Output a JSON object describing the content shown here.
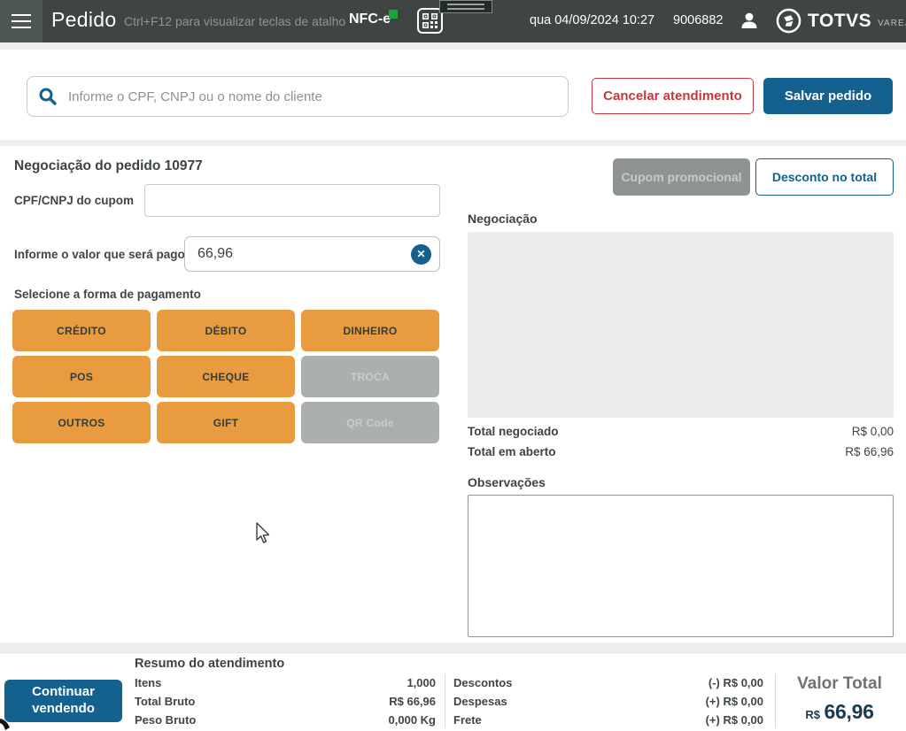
{
  "header": {
    "title": "Pedido",
    "shortcut_hint": "Ctrl+F12 para visualizar teclas de atalho",
    "nfce_label": "NFC-e",
    "datetime": "qua 04/09/2024 10:27",
    "terminal_number": "9006882",
    "brand": "TOTVS",
    "brand_segment": "VAREJO"
  },
  "search": {
    "placeholder": "Informe o CPF, CNPJ ou o nome do cliente",
    "cancel_button": "Cancelar atendimento",
    "save_button": "Salvar pedido"
  },
  "negotiation": {
    "title": "Negociação do pedido 10977",
    "coupon_cpf_label": "CPF/CNPJ do cupom",
    "coupon_cpf_value": "",
    "amount_label": "Informe o valor que será pago",
    "amount_value": "66,96",
    "clear_icon_glyph": "✕",
    "payment_section_label": "Selecione a forma de pagamento",
    "payment_methods": [
      {
        "label": "CRÉDITO",
        "enabled": true
      },
      {
        "label": "DÉBITO",
        "enabled": true
      },
      {
        "label": "DINHEIRO",
        "enabled": true
      },
      {
        "label": "POS",
        "enabled": true
      },
      {
        "label": "CHEQUE",
        "enabled": true
      },
      {
        "label": "TROCA",
        "enabled": false
      },
      {
        "label": "OUTROS",
        "enabled": true
      },
      {
        "label": "GIFT",
        "enabled": true
      },
      {
        "label": "QR Code",
        "enabled": false
      }
    ],
    "promo_coupon_button": "Cupom promocional",
    "discount_button": "Desconto no total",
    "panel_label": "Negociação",
    "totals": [
      {
        "label": "Total negociado",
        "value": "R$ 0,00"
      },
      {
        "label": "Total em aberto",
        "value": "R$ 66,96"
      }
    ],
    "observations_label": "Observações",
    "observations_value": ""
  },
  "footer": {
    "continue_button": "Continuar vendendo",
    "summary_title": "Resumo do atendimento",
    "summary_left": [
      {
        "label": "Itens",
        "value": "1,000"
      },
      {
        "label": "Total Bruto",
        "value": "R$ 66,96"
      },
      {
        "label": "Peso Bruto",
        "value": "0,000 Kg"
      }
    ],
    "summary_right": [
      {
        "label": "Descontos",
        "value": "(-) R$ 0,00"
      },
      {
        "label": "Despesas",
        "value": "(+) R$ 0,00"
      },
      {
        "label": "Frete",
        "value": "(+) R$ 0,00"
      }
    ],
    "total_label": "Valor Total",
    "total_currency": "R$",
    "total_value": "66,96"
  },
  "colors": {
    "header_bg": "#3e4543",
    "primary_blue": "#14608f",
    "danger_red": "#c5393c",
    "payment_orange": "#e99b3f",
    "disabled_gray": "#abb0ae",
    "nfce_green": "#1ba53b",
    "total_navy": "#1b3a50"
  }
}
